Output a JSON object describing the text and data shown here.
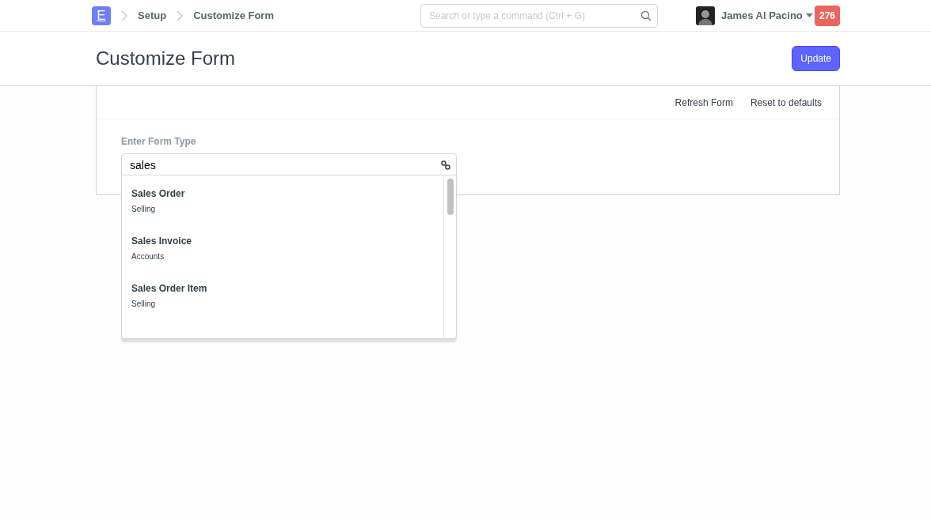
{
  "navbar": {
    "logo": "E",
    "breadcrumbs": [
      "Setup",
      "Customize Form"
    ],
    "search": {
      "placeholder": "Search or type a command (Ctrl + G)"
    },
    "user": "James Al Pacino",
    "notifications": "276"
  },
  "page": {
    "title": "Customize Form",
    "primary_button": "Update"
  },
  "toolbar": [
    "Refresh Form",
    "Reset to defaults"
  ],
  "field": {
    "label": "Enter Form Type",
    "value": "sales"
  },
  "suggestions": [
    {
      "title": "Sales Order",
      "module": "Selling"
    },
    {
      "title": "Sales Invoice",
      "module": "Accounts"
    },
    {
      "title": "Sales Order Item",
      "module": "Selling"
    }
  ]
}
